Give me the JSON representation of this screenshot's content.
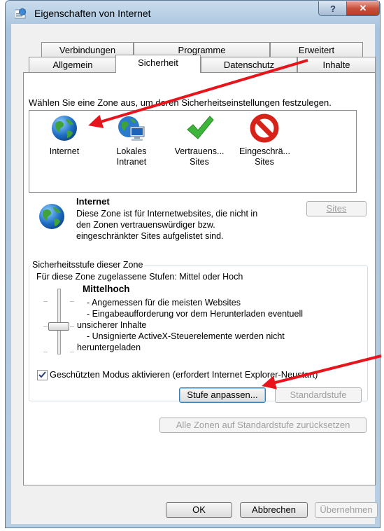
{
  "window": {
    "title": "Eigenschaften von Internet"
  },
  "tabs_top": [
    "Verbindungen",
    "Programme",
    "Erweitert"
  ],
  "tabs_bottom": [
    "Allgemein",
    "Sicherheit",
    "Datenschutz",
    "Inhalte"
  ],
  "zone_prompt": "Wählen Sie eine Zone aus, um deren Sicherheitseinstellungen festzulegen.",
  "zones": [
    {
      "line1": "Internet",
      "line2": "",
      "icon": "globe-icon"
    },
    {
      "line1": "Lokales",
      "line2": "Intranet",
      "icon": "intranet-icon"
    },
    {
      "line1": "Vertrauens...",
      "line2": "Sites",
      "icon": "checkmark-icon"
    },
    {
      "line1": "Eingeschrä...",
      "line2": "Sites",
      "icon": "restricted-icon"
    }
  ],
  "zone_info": {
    "title": "Internet",
    "lines": [
      "Diese Zone ist für Internetwebsites, die nicht in",
      "den Zonen vertrauenswürdiger bzw.",
      "eingeschränkter Sites aufgelistet sind."
    ],
    "sites_button": "Sites"
  },
  "security_level": {
    "group_title": "Sicherheitsstufe dieser Zone",
    "allowed": "Für diese Zone zugelassene Stufen: Mittel oder Hoch",
    "level_name": "Mittelhoch",
    "lines": [
      "- Angemessen für die meisten Websites",
      "- Eingabeaufforderung vor dem Herunterladen eventuell",
      "unsicherer Inhalte",
      "- Unsignierte ActiveX-Steuerelemente werden nicht",
      "heruntergeladen"
    ]
  },
  "protected_mode": {
    "label": "Geschützten Modus aktivieren (erfordert Internet Explorer-Neustart)",
    "checked": true
  },
  "buttons": {
    "custom_level": "Stufe anpassen...",
    "default_level": "Standardstufe",
    "reset_all": "Alle Zonen auf Standardstufe zurücksetzen",
    "ok": "OK",
    "cancel": "Abbrechen",
    "apply": "Übernehmen"
  },
  "colors": {
    "annotation_arrow": "#e8141c",
    "accent_blue": "#3399ff"
  }
}
